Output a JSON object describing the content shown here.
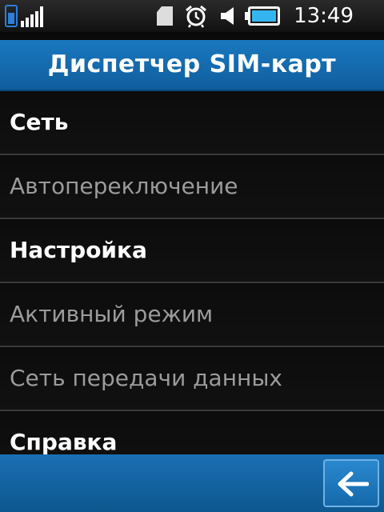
{
  "status_bar": {
    "time": "13:49",
    "icons": [
      "sim-signal-icon",
      "sd-card-icon",
      "alarm-icon",
      "speaker-icon",
      "battery-icon"
    ]
  },
  "header": {
    "title": "Диспетчер SIM-карт"
  },
  "menu": {
    "items": [
      {
        "label": "Сеть",
        "enabled": true
      },
      {
        "label": "Автопереключение",
        "enabled": false
      },
      {
        "label": "Настройка",
        "enabled": true
      },
      {
        "label": "Активный режим",
        "enabled": false
      },
      {
        "label": "Сеть передачи данных",
        "enabled": false
      },
      {
        "label": "Справка",
        "enabled": true
      }
    ]
  },
  "footer": {
    "back_icon": "back-arrow-icon"
  },
  "colors": {
    "accent": "#1a78bf",
    "battery": "#35b4f0",
    "text_enabled": "#ffffff",
    "text_disabled": "#9b9b9b"
  }
}
